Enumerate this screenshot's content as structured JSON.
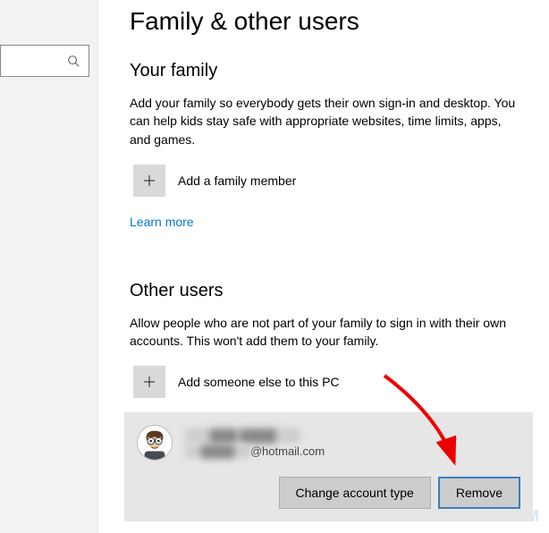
{
  "header": {
    "title": "Family & other users"
  },
  "family": {
    "heading": "Your family",
    "description": "Add your family so everybody gets their own sign-in and desktop. You can help kids stay safe with appropriate websites, time limits, apps, and games.",
    "add_label": "Add a family member",
    "learn_more": "Learn more"
  },
  "other": {
    "heading": "Other users",
    "description": "Allow people who are not part of your family to sign in with their own accounts. This won't add them to your family.",
    "add_label": "Add someone else to this PC"
  },
  "user": {
    "name_redacted": "███ ████",
    "email_suffix": "@hotmail.com",
    "change_type_label": "Change account type",
    "remove_label": "Remove"
  },
  "watermark": "WINDOWSDIGITAL.COM"
}
